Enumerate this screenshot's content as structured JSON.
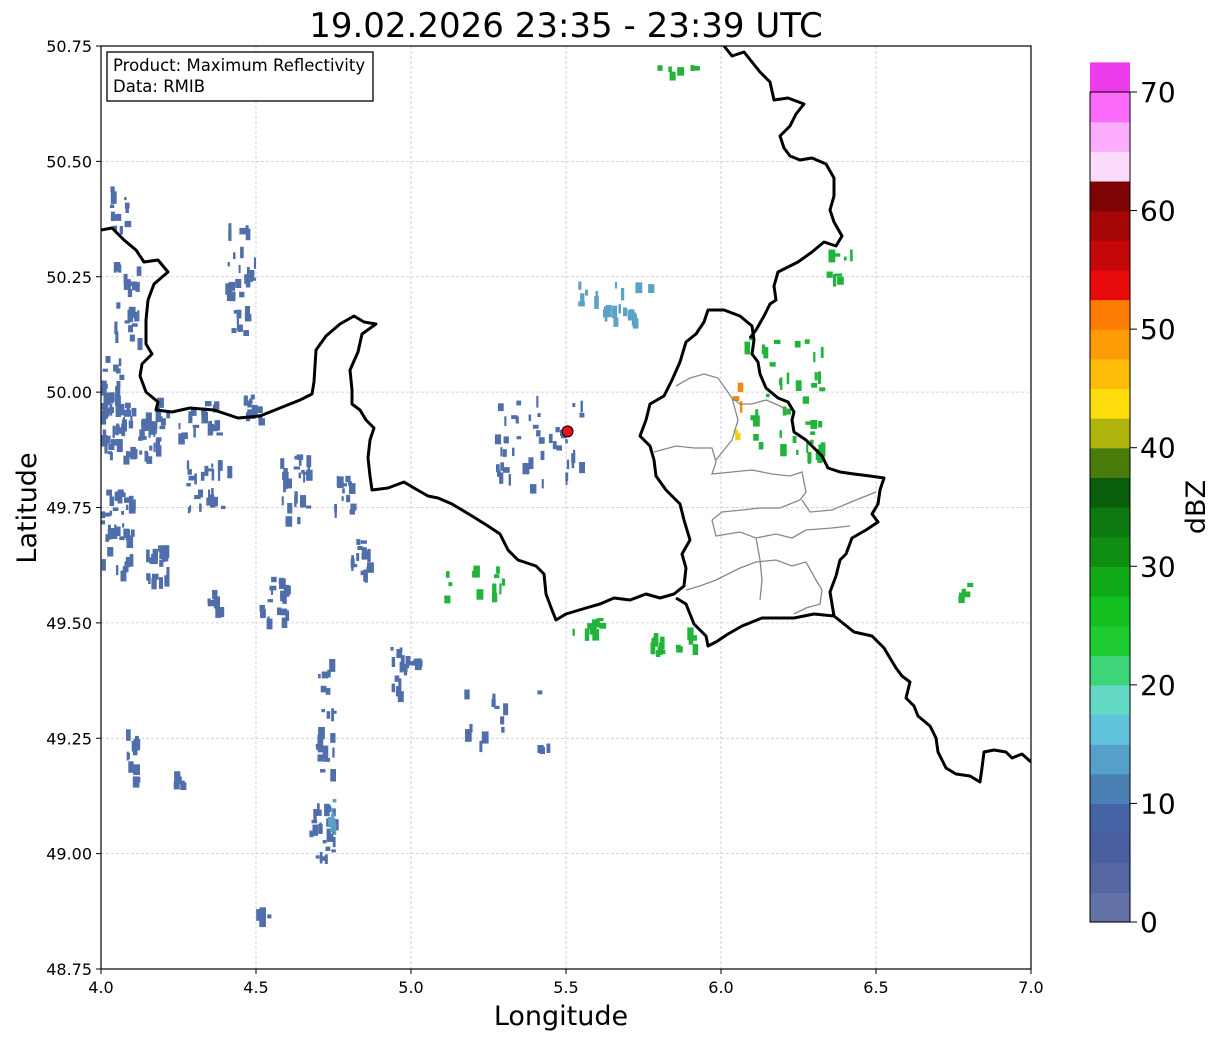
{
  "title": "19.02.2026 23:35 - 23:39 UTC",
  "xaxis": {
    "label": "Longitude",
    "range": [
      4.0,
      7.0
    ],
    "ticks": [
      "4.0",
      "4.5",
      "5.0",
      "5.5",
      "6.0",
      "6.5",
      "7.0"
    ]
  },
  "yaxis": {
    "label": "Latitude",
    "range": [
      48.75,
      50.75
    ],
    "ticks": [
      "48.75",
      "49.00",
      "49.25",
      "49.50",
      "49.75",
      "50.00",
      "50.25",
      "50.50",
      "50.75"
    ]
  },
  "grid": true,
  "info_box": {
    "product": "Product: Maximum Reflectivity",
    "source": "Data: RMIB"
  },
  "radar_site": {
    "lon": 5.505,
    "lat": 49.915,
    "color": "#e8101a"
  },
  "colorbar": {
    "label": "dBZ",
    "range": [
      0,
      70
    ],
    "step": 2.5,
    "ticks": [
      "0",
      "10",
      "20",
      "30",
      "40",
      "50",
      "60",
      "70"
    ],
    "colors": [
      "#6272a6",
      "#5567a2",
      "#4a5fa0",
      "#4664a6",
      "#4a7fb4",
      "#54a0c8",
      "#62c3dc",
      "#63d9c6",
      "#3ed47a",
      "#1ccc30",
      "#14c020",
      "#10aa18",
      "#108e12",
      "#0c7810",
      "#095e0c",
      "#4a7c0c",
      "#afb40c",
      "#fcdc0a",
      "#fcbc08",
      "#fc9c06",
      "#fc7c04",
      "#e80a0a",
      "#c40808",
      "#a40606",
      "#7c0404",
      "#fcdcfc",
      "#fcacfc",
      "#fc6cfc",
      "#ec3cec"
    ]
  },
  "echo_colors": {
    "weak": "#4f6eaa",
    "medium": "#5da2c6",
    "green": "#22b43a",
    "yellow": "#f0d010",
    "orange": "#f08a10"
  },
  "border_colors": {
    "country": "#000000",
    "province": "#888888"
  },
  "echo_clusters": [
    {
      "lon": 4.03,
      "lat": 49.97,
      "w": 0.1,
      "h": 0.22,
      "n": 50,
      "c": "weak"
    },
    {
      "lon": 4.12,
      "lat": 49.92,
      "w": 0.12,
      "h": 0.12,
      "n": 35,
      "c": "weak"
    },
    {
      "lon": 4.05,
      "lat": 49.7,
      "w": 0.1,
      "h": 0.18,
      "n": 40,
      "c": "weak"
    },
    {
      "lon": 4.18,
      "lat": 49.63,
      "w": 0.08,
      "h": 0.08,
      "n": 20,
      "c": "weak"
    },
    {
      "lon": 4.25,
      "lat": 49.95,
      "w": 0.25,
      "h": 0.08,
      "n": 30,
      "c": "weak"
    },
    {
      "lon": 4.35,
      "lat": 49.8,
      "w": 0.15,
      "h": 0.12,
      "n": 25,
      "c": "weak"
    },
    {
      "lon": 4.05,
      "lat": 50.4,
      "w": 0.06,
      "h": 0.1,
      "n": 12,
      "c": "weak"
    },
    {
      "lon": 4.08,
      "lat": 50.2,
      "w": 0.08,
      "h": 0.18,
      "n": 25,
      "c": "weak"
    },
    {
      "lon": 4.45,
      "lat": 50.25,
      "w": 0.1,
      "h": 0.25,
      "n": 30,
      "c": "weak"
    },
    {
      "lon": 4.48,
      "lat": 49.97,
      "w": 0.06,
      "h": 0.06,
      "n": 12,
      "c": "weak"
    },
    {
      "lon": 4.62,
      "lat": 49.8,
      "w": 0.1,
      "h": 0.15,
      "n": 25,
      "c": "weak"
    },
    {
      "lon": 4.78,
      "lat": 49.78,
      "w": 0.06,
      "h": 0.08,
      "n": 15,
      "c": "weak"
    },
    {
      "lon": 4.83,
      "lat": 49.65,
      "w": 0.06,
      "h": 0.08,
      "n": 18,
      "c": "weak"
    },
    {
      "lon": 4.55,
      "lat": 49.55,
      "w": 0.1,
      "h": 0.1,
      "n": 20,
      "c": "weak"
    },
    {
      "lon": 4.36,
      "lat": 49.55,
      "w": 0.04,
      "h": 0.05,
      "n": 6,
      "c": "weak"
    },
    {
      "lon": 4.97,
      "lat": 49.4,
      "w": 0.1,
      "h": 0.12,
      "n": 22,
      "c": "weak"
    },
    {
      "lon": 4.72,
      "lat": 49.3,
      "w": 0.06,
      "h": 0.25,
      "n": 25,
      "c": "weak"
    },
    {
      "lon": 4.71,
      "lat": 49.05,
      "w": 0.08,
      "h": 0.12,
      "n": 25,
      "c": "weak"
    },
    {
      "lon": 4.74,
      "lat": 49.09,
      "w": 0.03,
      "h": 0.06,
      "n": 8,
      "c": "medium"
    },
    {
      "lon": 4.1,
      "lat": 49.22,
      "w": 0.04,
      "h": 0.12,
      "n": 12,
      "c": "weak"
    },
    {
      "lon": 4.25,
      "lat": 49.17,
      "w": 0.04,
      "h": 0.05,
      "n": 6,
      "c": "weak"
    },
    {
      "lon": 4.52,
      "lat": 48.88,
      "w": 0.04,
      "h": 0.04,
      "n": 5,
      "c": "weak"
    },
    {
      "lon": 5.4,
      "lat": 49.9,
      "w": 0.3,
      "h": 0.2,
      "n": 45,
      "c": "weak"
    },
    {
      "lon": 5.65,
      "lat": 50.2,
      "w": 0.25,
      "h": 0.08,
      "n": 25,
      "c": "medium"
    },
    {
      "lon": 6.2,
      "lat": 50.0,
      "w": 0.25,
      "h": 0.25,
      "n": 35,
      "c": "green"
    },
    {
      "lon": 6.3,
      "lat": 49.9,
      "w": 0.05,
      "h": 0.1,
      "n": 10,
      "c": "green"
    },
    {
      "lon": 6.38,
      "lat": 50.28,
      "w": 0.08,
      "h": 0.08,
      "n": 8,
      "c": "green"
    },
    {
      "lon": 5.85,
      "lat": 49.47,
      "w": 0.18,
      "h": 0.06,
      "n": 15,
      "c": "green"
    },
    {
      "lon": 5.55,
      "lat": 49.5,
      "w": 0.12,
      "h": 0.04,
      "n": 10,
      "c": "green"
    },
    {
      "lon": 6.78,
      "lat": 49.58,
      "w": 0.03,
      "h": 0.06,
      "n": 5,
      "c": "green"
    },
    {
      "lon": 5.85,
      "lat": 50.7,
      "w": 0.15,
      "h": 0.02,
      "n": 6,
      "c": "green"
    },
    {
      "lon": 6.05,
      "lat": 50.0,
      "w": 0.03,
      "h": 0.05,
      "n": 3,
      "c": "orange"
    },
    {
      "lon": 6.04,
      "lat": 49.92,
      "w": 0.02,
      "h": 0.02,
      "n": 2,
      "c": "yellow"
    },
    {
      "lon": 5.2,
      "lat": 49.6,
      "w": 0.2,
      "h": 0.1,
      "n": 12,
      "c": "green"
    },
    {
      "lon": 5.3,
      "lat": 49.3,
      "w": 0.3,
      "h": 0.15,
      "n": 15,
      "c": "weak"
    }
  ]
}
